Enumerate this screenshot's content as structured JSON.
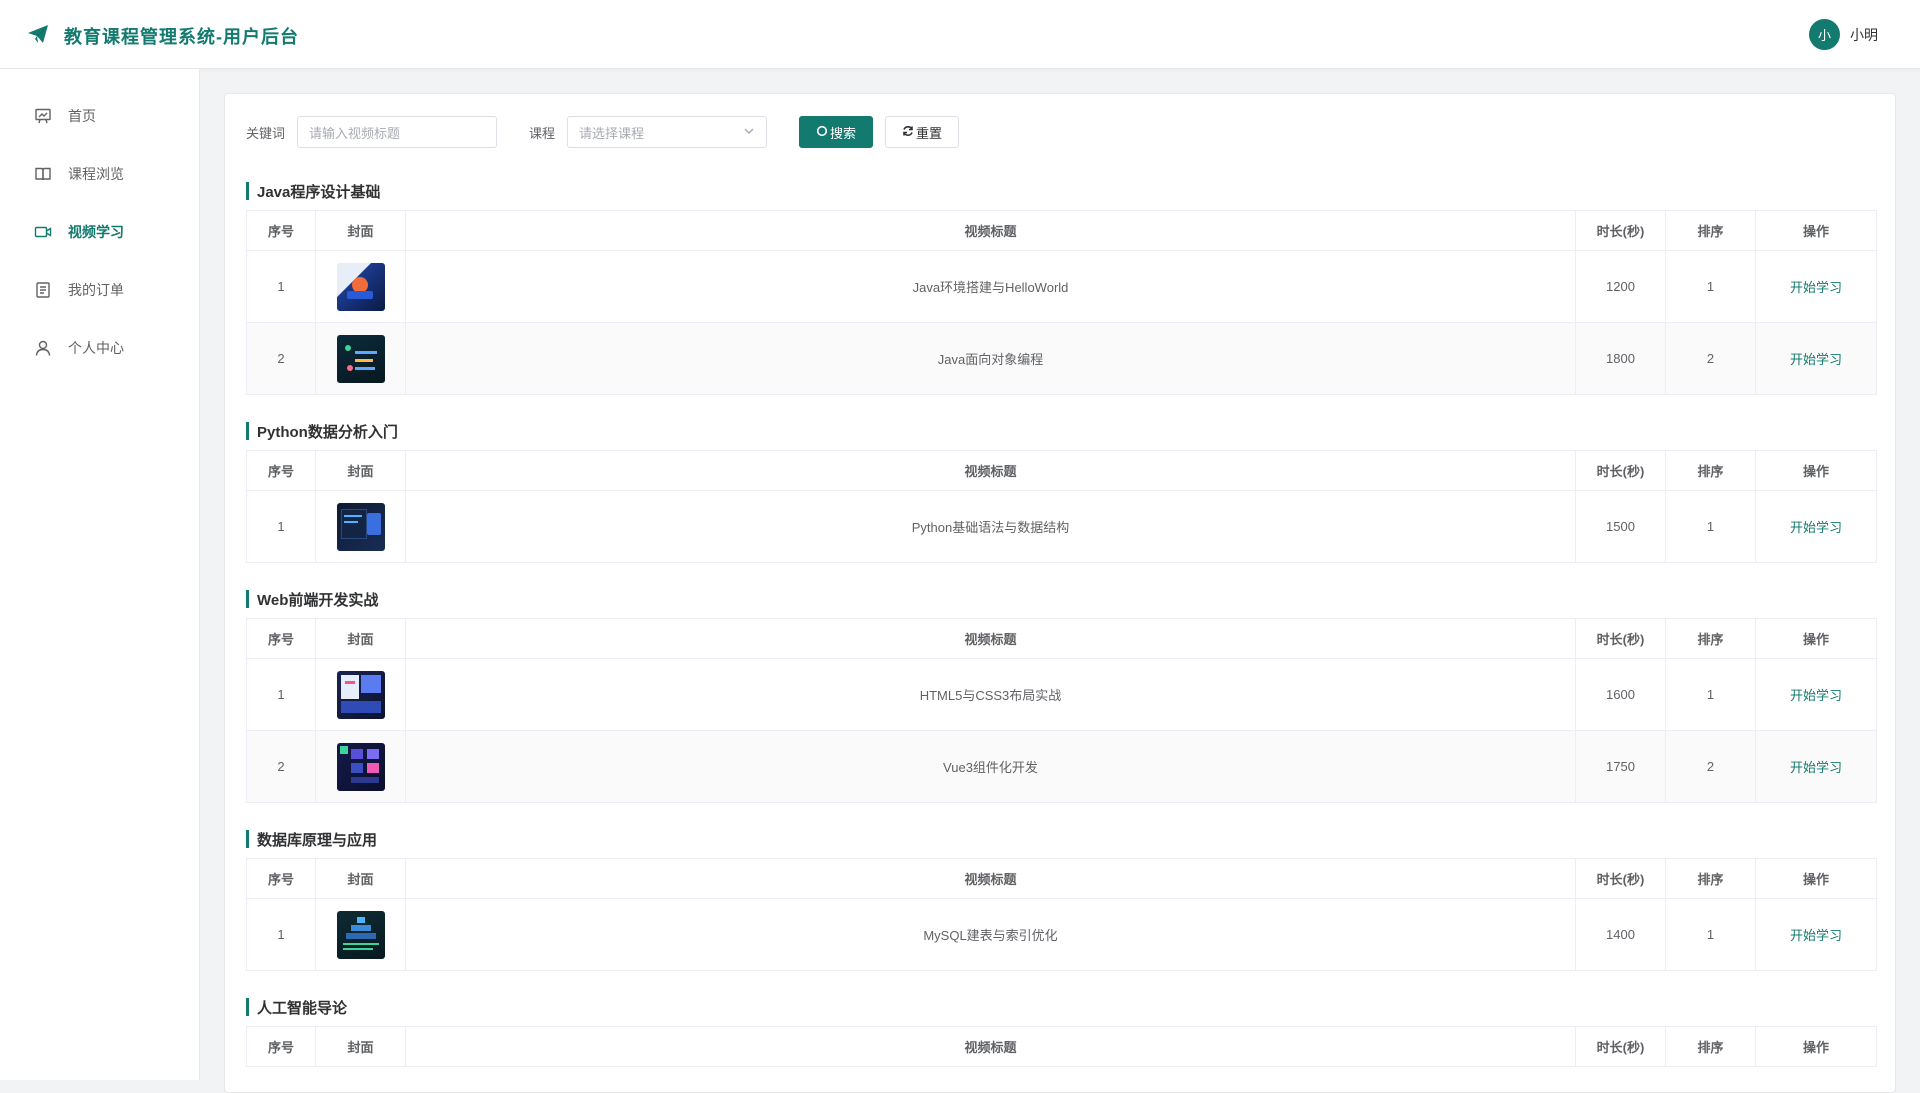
{
  "app": {
    "title": "教育课程管理系统-用户后台"
  },
  "user": {
    "avatar_char": "小",
    "name": "小明"
  },
  "sidebar": {
    "items": [
      {
        "label": "首页",
        "icon": "home-icon",
        "active": false
      },
      {
        "label": "课程浏览",
        "icon": "book-icon",
        "active": false
      },
      {
        "label": "视频学习",
        "icon": "video-icon",
        "active": true
      },
      {
        "label": "我的订单",
        "icon": "order-icon",
        "active": false
      },
      {
        "label": "个人中心",
        "icon": "user-icon",
        "active": false
      }
    ]
  },
  "filters": {
    "keyword_label": "关键词",
    "keyword_placeholder": "请输入视频标题",
    "course_label": "课程",
    "course_placeholder": "请选择课程",
    "search_label": "搜索",
    "reset_label": "重置"
  },
  "table_headers": {
    "index": "序号",
    "cover": "封面",
    "title": "视频标题",
    "duration": "时长(秒)",
    "order": "排序",
    "action": "操作"
  },
  "sections": [
    {
      "title": "Java程序设计基础",
      "rows": [
        {
          "index": "1",
          "title": "Java环境搭建与HelloWorld",
          "duration": "1200",
          "order": "1",
          "action": "开始学习"
        },
        {
          "index": "2",
          "title": "Java面向对象编程",
          "duration": "1800",
          "order": "2",
          "action": "开始学习"
        }
      ]
    },
    {
      "title": "Python数据分析入门",
      "rows": [
        {
          "index": "1",
          "title": "Python基础语法与数据结构",
          "duration": "1500",
          "order": "1",
          "action": "开始学习"
        }
      ]
    },
    {
      "title": "Web前端开发实战",
      "rows": [
        {
          "index": "1",
          "title": "HTML5与CSS3布局实战",
          "duration": "1600",
          "order": "1",
          "action": "开始学习"
        },
        {
          "index": "2",
          "title": "Vue3组件化开发",
          "duration": "1750",
          "order": "2",
          "action": "开始学习"
        }
      ]
    },
    {
      "title": "数据库原理与应用",
      "rows": [
        {
          "index": "1",
          "title": "MySQL建表与索引优化",
          "duration": "1400",
          "order": "1",
          "action": "开始学习"
        }
      ]
    },
    {
      "title": "人工智能导论",
      "rows": []
    }
  ],
  "colors": {
    "accent": "#127a6e",
    "text": "#303133",
    "muted": "#606266",
    "border": "#ebeef5"
  }
}
